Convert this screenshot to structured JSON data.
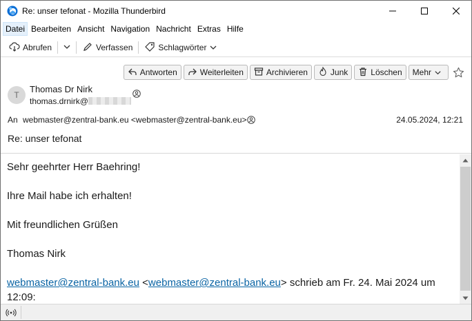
{
  "window": {
    "title": "Re: unser tefonat - Mozilla Thunderbird"
  },
  "menubar": {
    "items": [
      {
        "label": "Datei",
        "name": "menu-datei"
      },
      {
        "label": "Bearbeiten",
        "name": "menu-bearbeiten"
      },
      {
        "label": "Ansicht",
        "name": "menu-ansicht"
      },
      {
        "label": "Navigation",
        "name": "menu-navigation"
      },
      {
        "label": "Nachricht",
        "name": "menu-nachricht"
      },
      {
        "label": "Extras",
        "name": "menu-extras"
      },
      {
        "label": "Hilfe",
        "name": "menu-hilfe"
      }
    ]
  },
  "toolbar": {
    "get_messages": "Abrufen",
    "write": "Verfassen",
    "tags": "Schlagwörter"
  },
  "header_buttons": {
    "reply": "Antworten",
    "forward": "Weiterleiten",
    "archive": "Archivieren",
    "junk": "Junk",
    "delete": "Löschen",
    "more": "Mehr"
  },
  "message": {
    "avatar_initial": "T",
    "from_name": "Thomas Dr Nirk",
    "from_email_visible": "thomas.drnirk@",
    "to_label": "An",
    "to_value": "webmaster@zentral-bank.eu <webmaster@zentral-bank.eu>",
    "date": "24.05.2024, 12:21",
    "subject": "Re: unser tefonat",
    "body": {
      "greeting": "Sehr geehrter Herr Baehring!",
      "line1": "Ihre Mail habe ich erhalten!",
      "closing": "Mit freundlichen Grüßen",
      "signature": "Thomas Nirk",
      "quote_link1": "webmaster@zentral-bank.eu",
      "quote_open": " <",
      "quote_link2": "webmaster@zentral-bank.eu",
      "quote_rest": "> schrieb am Fr. 24. Mai 2024 um",
      "quote_time": "12:09:"
    }
  },
  "colors": {
    "link": "#0a64a4",
    "thunderbird_blue": "#0b6fd6"
  }
}
